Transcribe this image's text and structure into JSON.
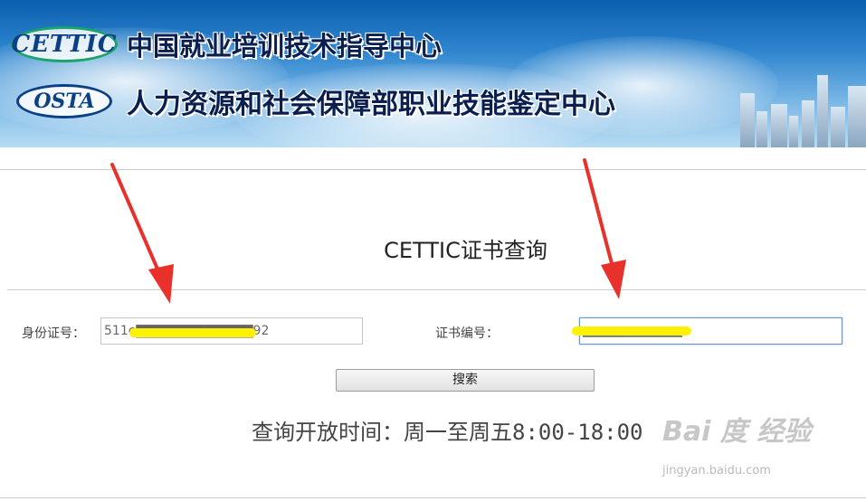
{
  "banner": {
    "logo1": "CETTIC",
    "title1": "中国就业培训技术指导中心",
    "logo2": "OSTA",
    "title2": "人力资源和社会保障部职业技能鉴定中心"
  },
  "page_title": "CETTIC证书查询",
  "form": {
    "id_label": "身份证号：",
    "id_value": "511ϵ▇▇▇▇▇▇▇▇▇▇▇▇92",
    "cert_label": "证书编号：",
    "cert_value": "▇▇▇▇▇▇▇▇▇▇▇▇▇",
    "search_button": "搜索"
  },
  "hours": "查询开放时间：周一至周五8:00-18:00",
  "watermark": {
    "brand": "Bai 度 经验",
    "url": "jingyan.baidu.com"
  },
  "colors": {
    "arrow": "#e8312a",
    "highlighter": "#fff200",
    "banner_top": "#0a5fae"
  }
}
